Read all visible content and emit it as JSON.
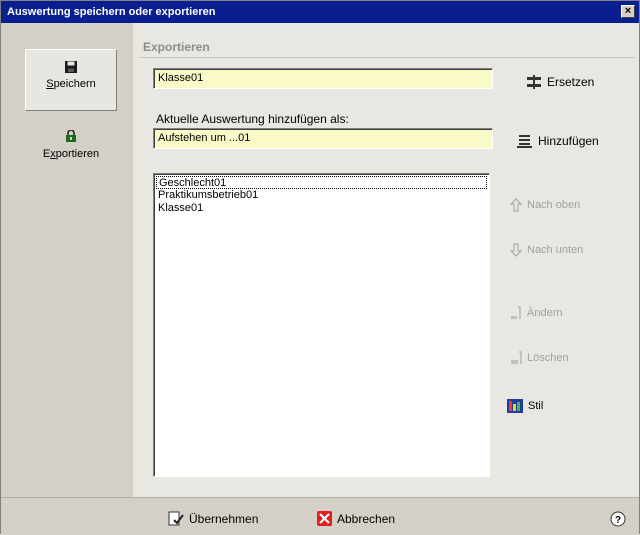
{
  "window": {
    "title": "Auswertung speichern oder exportieren",
    "close_glyph": "×"
  },
  "sidebar": {
    "items": [
      {
        "label": "Speichern",
        "icon": "floppy-disk-icon",
        "active": true
      },
      {
        "label": "Exportieren",
        "icon": "export-icon",
        "active": false
      }
    ]
  },
  "main": {
    "section_title": "Exportieren",
    "name_field_value": "Klasse01",
    "add_as_label": "Aktuelle Auswertung hinzufügen als:",
    "add_as_field_value": "Aufstehen um ...01",
    "list_items": [
      "Geschlecht01",
      "Praktikumsbetrieb01",
      "Klasse01"
    ]
  },
  "actions": {
    "replace": "Ersetzen",
    "add": "Hinzufügen",
    "move_up": "Nach oben",
    "move_down": "Nach unten",
    "edit": "Ändern",
    "delete": "Löschen",
    "style": "Stil"
  },
  "footer": {
    "apply": "Übernehmen",
    "cancel": "Abbrechen",
    "help_glyph": "?"
  }
}
